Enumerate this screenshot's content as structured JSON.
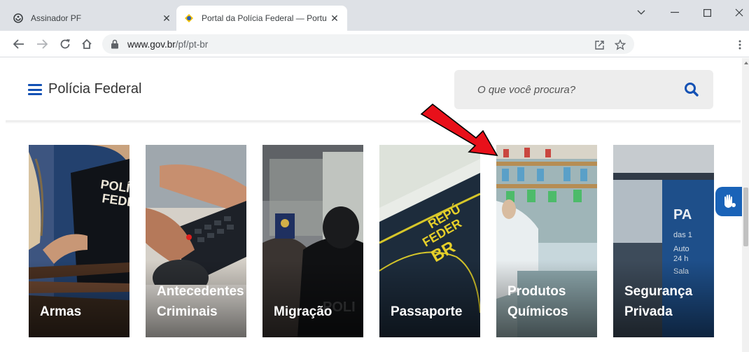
{
  "browser": {
    "tabs": [
      {
        "title": "Assinador PF",
        "icon": "globe-icon"
      },
      {
        "title": "Portal da Polícia Federal — Portu",
        "icon": "brazil-flag-icon"
      }
    ],
    "address_host": "www.gov.br",
    "address_path": "/pf/pt-br"
  },
  "header": {
    "brand": "Polícia Federal",
    "search_placeholder": "O que você procura?"
  },
  "cards": [
    {
      "label_line1": "",
      "label_line2": "Armas"
    },
    {
      "label_line1": "Antecedentes",
      "label_line2": "Criminais"
    },
    {
      "label_line1": "",
      "label_line2": "Migração"
    },
    {
      "label_line1": "",
      "label_line2": "Passaporte"
    },
    {
      "label_line1": "Produtos",
      "label_line2": "Químicos"
    },
    {
      "label_line1": "Segurança",
      "label_line2": "Privada"
    }
  ],
  "colors": {
    "accent": "#1351b4",
    "annotation_arrow": "#e8101a"
  }
}
